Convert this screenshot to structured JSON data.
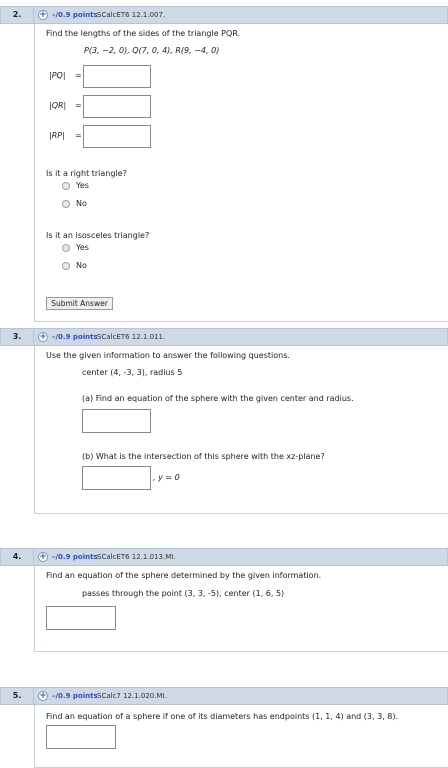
{
  "q2": {
    "number": "2.",
    "points": "–/0.9 points",
    "source": "SCalcET6 12.1.007.",
    "prompt": "Find the lengths of the sides of the triangle PQR.",
    "points_line": "P(3, −2, 0),   Q(7, 0, 4),   R(9, −4, 0)",
    "labels": [
      "|PQ|",
      "|QR|",
      "|RP|"
    ],
    "eq": "=",
    "question_right": "Is it a right triangle?",
    "question_iso": "Is it an isosceles triangle?",
    "yes": "Yes",
    "no": "No",
    "submit": "Submit Answer"
  },
  "q3": {
    "number": "3.",
    "points": "–/0.9 points",
    "source": "SCalcET6 12.1.011.",
    "prompt": "Use the given information to answer the following questions.",
    "given": "center (4, -3, 3),      radius 5",
    "part_a": "(a) Find an equation of the sphere with the given center and radius.",
    "part_b": "(b) What is the intersection of this sphere with the xz-plane?",
    "suffix": ", y = 0"
  },
  "q4": {
    "number": "4.",
    "points": "–/0.9 points",
    "source": "SCalcET6 12.1.013.MI.",
    "prompt": "Find an equation of the sphere determined by the given information.",
    "given": "passes through the point (3, 3, -5),     center (1, 6, 5)"
  },
  "q5": {
    "number": "5.",
    "points": "–/0.9 points",
    "source": "SCalc7 12.1.020.MI.",
    "prompt": "Find an equation of a sphere if one of its diameters has endpoints  (1, 1, 4) and (3, 3, 8)."
  }
}
